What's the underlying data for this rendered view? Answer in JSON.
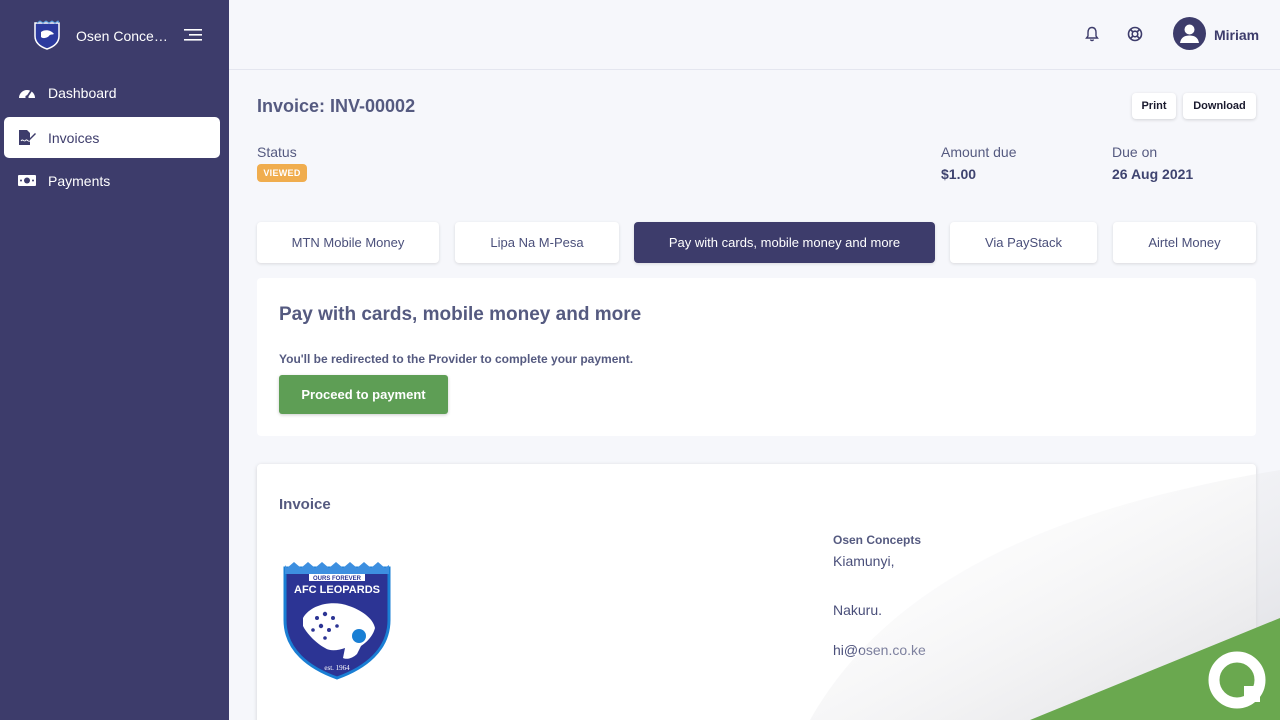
{
  "sidebar": {
    "brand_name": "Osen Concepts",
    "items": [
      {
        "label": "Dashboard",
        "icon": "gauge-icon"
      },
      {
        "label": "Invoices",
        "icon": "file-signature-icon"
      },
      {
        "label": "Payments",
        "icon": "money-bill-icon"
      }
    ]
  },
  "topbar": {
    "user_name": "Miriam"
  },
  "invoice": {
    "title": "Invoice: INV-00002",
    "print_label": "Print",
    "download_label": "Download",
    "status_label": "Status",
    "status_value": "VIEWED",
    "amount_label": "Amount due",
    "amount_value": "$1.00",
    "due_label": "Due on",
    "due_value": "26 Aug 2021"
  },
  "payment_tabs": [
    {
      "label": "MTN Mobile Money",
      "active": false
    },
    {
      "label": "Lipa Na M-Pesa",
      "active": false
    },
    {
      "label": "Pay with cards, mobile money and more",
      "active": true
    },
    {
      "label": "Via PayStack",
      "active": false
    },
    {
      "label": "Airtel Money",
      "active": false
    }
  ],
  "payment_card": {
    "title": "Pay with cards, mobile money and more",
    "note": "You'll be redirected to the Provider to complete your payment.",
    "button_label": "Proceed to payment"
  },
  "invoice_card": {
    "title": "Invoice",
    "logo_text_top": "OURS FOREVER",
    "logo_text_main": "AFC LEOPARDS",
    "logo_text_est": "est. 1964",
    "company_name": "Osen Concepts",
    "address_line1": "Kiamunyi,",
    "address_line2": "Nakuru.",
    "email": "hi@osen.co.ke"
  },
  "colors": {
    "sidebar_bg": "#3d3c6b",
    "status_badge": "#f0ad4e",
    "proceed_button": "#5e9e55",
    "active_tab": "#3d3c6b"
  }
}
